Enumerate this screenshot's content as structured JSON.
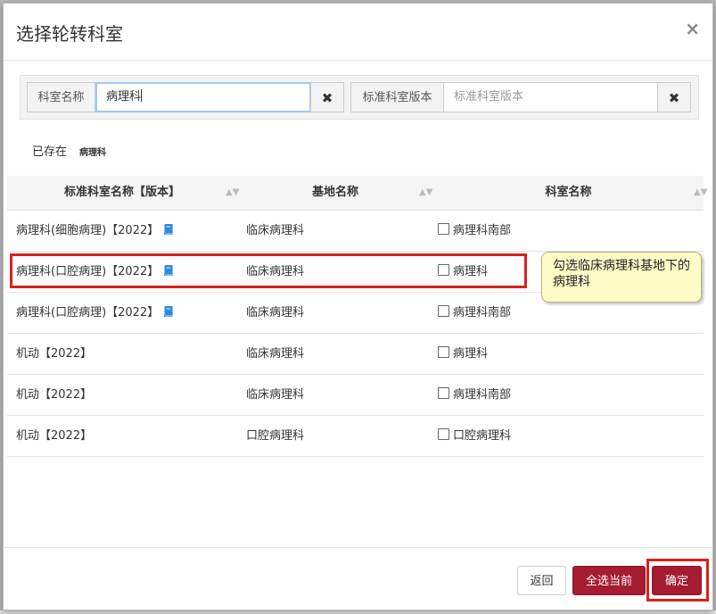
{
  "dialog": {
    "title": "选择轮转科室",
    "close_label": "×"
  },
  "search": {
    "dept_label": "科室名称",
    "dept_value": "病理科",
    "clear_label": "✖",
    "version_label": "标准科室版本",
    "version_placeholder": "标准科室版本"
  },
  "existing": {
    "label": "已存在",
    "tag": "病理科"
  },
  "table": {
    "headers": [
      "标准科室名称【版本】",
      "基地名称",
      "科室名称"
    ],
    "sort_icon": "▲▼",
    "rows": [
      {
        "std": "病理科(细胞病理)【2022】",
        "has_book": true,
        "base": "临床病理科",
        "dept": "病理科南部"
      },
      {
        "std": "病理科(口腔病理)【2022】",
        "has_book": true,
        "base": "临床病理科",
        "dept": "病理科"
      },
      {
        "std": "病理科(口腔病理)【2022】",
        "has_book": true,
        "base": "临床病理科",
        "dept": "病理科南部"
      },
      {
        "std": "机动【2022】",
        "has_book": false,
        "base": "临床病理科",
        "dept": "病理科"
      },
      {
        "std": "机动【2022】",
        "has_book": false,
        "base": "临床病理科",
        "dept": "病理科南部"
      },
      {
        "std": "机动【2022】",
        "has_book": false,
        "base": "口腔病理科",
        "dept": "口腔病理科"
      }
    ]
  },
  "callout": {
    "text": "勾选临床病理科基地下的病理科"
  },
  "footer": {
    "back_label": "返回",
    "select_all_label": "全选当前",
    "confirm_label": "确定"
  },
  "colors": {
    "primary": "#a51c30",
    "highlight": "#d9211b",
    "callout_bg": "#fefdc8",
    "book_icon": "#2a8be0"
  }
}
